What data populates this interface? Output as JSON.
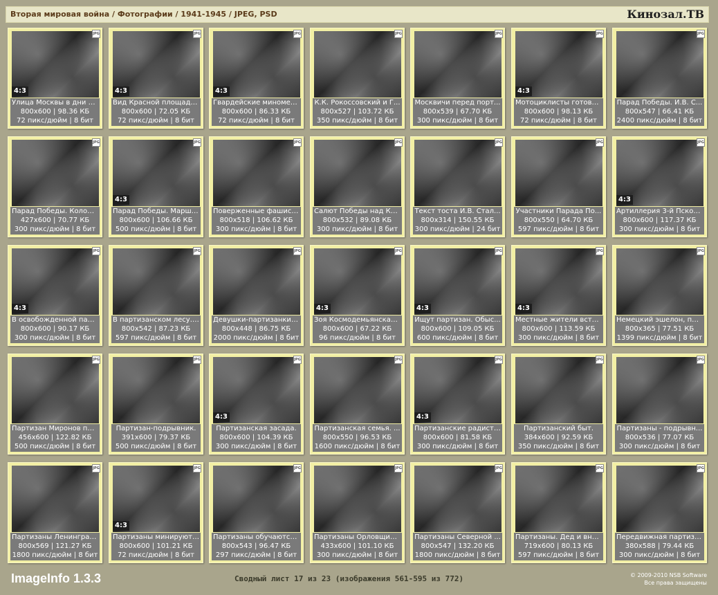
{
  "header": {
    "breadcrumb": "Вторая мировая война / Фотографии / 1941-1945 / JPEG, PSD",
    "brand": "Кинозал.ТВ"
  },
  "badge_ratio": "4:3",
  "jpg_icon": "JPG",
  "items": [
    {
      "title": "Улица Москвы в дни о...",
      "dims": "800x600 | 98.36 КБ",
      "meta": "72 пикс/дюйм | 8 бит",
      "ratio": true
    },
    {
      "title": "Вид Красной площади...",
      "dims": "800x600 | 72.05 КБ",
      "meta": "72 пикс/дюйм | 8 бит",
      "ratio": true
    },
    {
      "title": "Гвардейские миномет...",
      "dims": "800x600 | 86.33 КБ",
      "meta": "72 пикс/дюйм | 8 бит",
      "ratio": true
    },
    {
      "title": "К.К. Рокоссовский и Г...",
      "dims": "800x527 | 103.72 КБ",
      "meta": "350 пикс/дюйм | 8 бит",
      "ratio": false
    },
    {
      "title": "Москвичи перед порт...",
      "dims": "800x539 | 67.70 КБ",
      "meta": "300 пикс/дюйм | 8 бит",
      "ratio": false
    },
    {
      "title": "Мотоциклисты готовя...",
      "dims": "800x600 | 98.13 КБ",
      "meta": "72 пикс/дюйм | 8 бит",
      "ratio": true
    },
    {
      "title": "Парад Победы. И.В. С...",
      "dims": "800x547 | 66.41 КБ",
      "meta": "2400 пикс/дюйм | 8 бит",
      "ratio": false
    },
    {
      "title": "Парад Победы. Колон...",
      "dims": "427x600 | 70.77 КБ",
      "meta": "300 пикс/дюйм | 8 бит",
      "ratio": false
    },
    {
      "title": "Парад Победы. Марш ...",
      "dims": "800x600 | 106.66 КБ",
      "meta": "500 пикс/дюйм | 8 бит",
      "ratio": true
    },
    {
      "title": "Поверженные фашист...",
      "dims": "800x518 | 106.62 КБ",
      "meta": "300 пикс/дюйм | 8 бит",
      "ratio": false
    },
    {
      "title": "Салют Победы над Кр...",
      "dims": "800x532 | 89.08 КБ",
      "meta": "300 пикс/дюйм | 8 бит",
      "ratio": false
    },
    {
      "title": "Текст тоста И.В. Стал...",
      "dims": "800x314 | 150.55 КБ",
      "meta": "300 пикс/дюйм | 24 бит",
      "ratio": false
    },
    {
      "title": "Участники Парада По...",
      "dims": "800x550 | 64.70 КБ",
      "meta": "597 пикс/дюйм | 8 бит",
      "ratio": false
    },
    {
      "title": "Артиллерия 3-й Псков...",
      "dims": "800x600 | 117.37 КБ",
      "meta": "300 пикс/дюйм | 8 бит",
      "ratio": true
    },
    {
      "title": "В освобожденной пар...",
      "dims": "800x600 | 90.17 КБ",
      "meta": "300 пикс/дюйм | 8 бит",
      "ratio": true
    },
    {
      "title": "В партизанском лесу. ...",
      "dims": "800x542 | 87.23 КБ",
      "meta": "597 пикс/дюйм | 8 бит",
      "ratio": false
    },
    {
      "title": "Девушки-партизанки ...",
      "dims": "800x448 | 86.75 КБ",
      "meta": "2000 пикс/дюйм | 8 бит",
      "ratio": false
    },
    {
      "title": "Зоя Космодемьянская ...",
      "dims": "800x600 | 67.22 КБ",
      "meta": "96 пикс/дюйм | 8 бит",
      "ratio": true
    },
    {
      "title": "Ищут партизан. Обыс...",
      "dims": "800x600 | 109.05 КБ",
      "meta": "600 пикс/дюйм | 8 бит",
      "ratio": true
    },
    {
      "title": "Местные жители встр...",
      "dims": "800x600 | 113.59 КБ",
      "meta": "300 пикс/дюйм | 8 бит",
      "ratio": true
    },
    {
      "title": "Немецкий эшелон, под...",
      "dims": "800x365 | 77.51 КБ",
      "meta": "1399 пикс/дюйм | 8 бит",
      "ratio": false
    },
    {
      "title": "Партизан Миронов по ...",
      "dims": "456x600 | 122.82 КБ",
      "meta": "500 пикс/дюйм | 8 бит",
      "ratio": false
    },
    {
      "title": "Партизан-подрывник.",
      "dims": "391x600 | 79.37 КБ",
      "meta": "500 пикс/дюйм | 8 бит",
      "ratio": false
    },
    {
      "title": "Партизанская засада.",
      "dims": "800x600 | 104.39 КБ",
      "meta": "300 пикс/дюйм | 8 бит",
      "ratio": true
    },
    {
      "title": "Партизанская семья. ...",
      "dims": "800x550 | 96.53 КБ",
      "meta": "1600 пикс/дюйм | 8 бит",
      "ratio": false
    },
    {
      "title": "Партизанские радисты.",
      "dims": "800x600 | 81.58 КБ",
      "meta": "300 пикс/дюйм | 8 бит",
      "ratio": true
    },
    {
      "title": "Партизанский быт.",
      "dims": "384x600 | 92.59 КБ",
      "meta": "350 пикс/дюйм | 8 бит",
      "ratio": false
    },
    {
      "title": "Партизаны - подрывн...",
      "dims": "800x536 | 77.07 КБ",
      "meta": "300 пикс/дюйм | 8 бит",
      "ratio": false
    },
    {
      "title": "Партизаны Ленинград...",
      "dims": "800x569 | 121.27 КБ",
      "meta": "1800 пикс/дюйм | 8 бит",
      "ratio": false
    },
    {
      "title": "Партизаны минируют ...",
      "dims": "800x600 | 101.21 КБ",
      "meta": "72 пикс/дюйм | 8 бит",
      "ratio": true
    },
    {
      "title": "Партизаны обучаются...",
      "dims": "800x543 | 96.47 КБ",
      "meta": "297 пикс/дюйм | 8 бит",
      "ratio": false
    },
    {
      "title": "Партизаны Орловщины.",
      "dims": "433x600 | 101.10 КБ",
      "meta": "300 пикс/дюйм | 8 бит",
      "ratio": false
    },
    {
      "title": "Партизаны Северной ...",
      "dims": "800x547 | 132.20 КБ",
      "meta": "1800 пикс/дюйм | 8 бит",
      "ratio": false
    },
    {
      "title": "Партизаны. Дед и внук.",
      "dims": "719x600 | 80.13 КБ",
      "meta": "597 пикс/дюйм | 8 бит",
      "ratio": false
    },
    {
      "title": "Передвижная партиза...",
      "dims": "380x588 | 79.44 КБ",
      "meta": "300 пикс/дюйм | 8 бит",
      "ratio": false
    }
  ],
  "footer": {
    "logo": "ImageInfo 1.3.3",
    "summary": "Сводный лист 17 из 23 (изображения 561-595 из 772)",
    "copyright_line1": "© 2009-2010 NSB Software",
    "copyright_line2": "Все права защищены"
  }
}
